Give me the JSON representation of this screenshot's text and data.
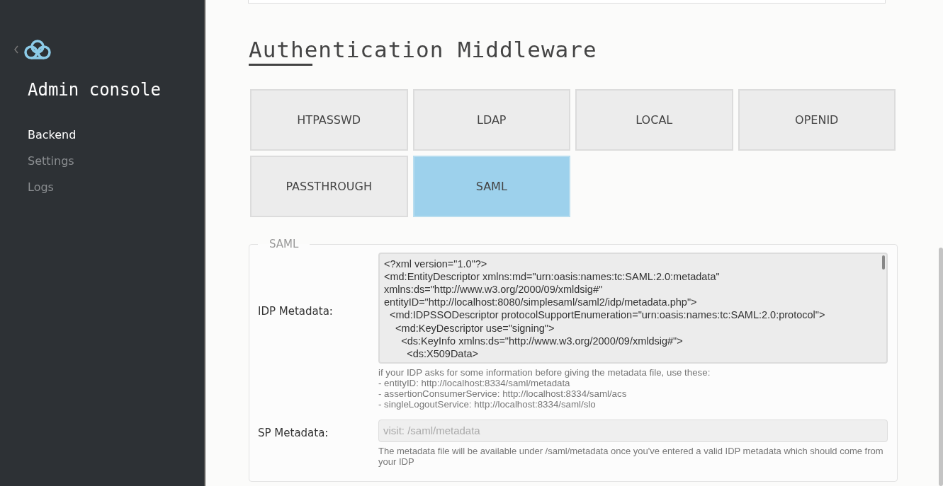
{
  "sidebar": {
    "title": "Admin console",
    "items": [
      {
        "label": "Backend",
        "selected": true
      },
      {
        "label": "Settings",
        "selected": false
      },
      {
        "label": "Logs",
        "selected": false
      }
    ]
  },
  "section": {
    "title": "Authentication Middleware"
  },
  "middlewares": [
    {
      "label": "HTPASSWD",
      "selected": false
    },
    {
      "label": "LDAP",
      "selected": false
    },
    {
      "label": "LOCAL",
      "selected": false
    },
    {
      "label": "OPENID",
      "selected": false
    },
    {
      "label": "PASSTHROUGH",
      "selected": false
    },
    {
      "label": "SAML",
      "selected": true
    }
  ],
  "form": {
    "legend": "SAML",
    "fields": [
      {
        "kind": "textarea",
        "label": "IDP Metadata:",
        "value": "<?xml version=\"1.0\"?>\n<md:EntityDescriptor xmlns:md=\"urn:oasis:names:tc:SAML:2.0:metadata\"\nxmlns:ds=\"http://www.w3.org/2000/09/xmldsig#\"\nentityID=\"http://localhost:8080/simplesaml/saml2/idp/metadata.php\">\n  <md:IDPSSODescriptor protocolSupportEnumeration=\"urn:oasis:names:tc:SAML:2.0:protocol\">\n    <md:KeyDescriptor use=\"signing\">\n      <ds:KeyInfo xmlns:ds=\"http://www.w3.org/2000/09/xmldsig#\">\n        <ds:X509Data>",
        "help": [
          "if your IDP asks for some information before giving the metadata file, use these:",
          "- entityID: http://localhost:8334/saml/metadata",
          "- assertionConsumerService: http://localhost:8334/saml/acs",
          "- singleLogoutService: http://localhost:8334/saml/slo"
        ]
      },
      {
        "kind": "input",
        "label": "SP Metadata:",
        "placeholder": "visit: /saml/metadata",
        "disabled": true,
        "help": [
          "The metadata file will be available under /saml/metadata once you've entered a valid IDP metadata which should come from your IDP"
        ]
      }
    ]
  }
}
